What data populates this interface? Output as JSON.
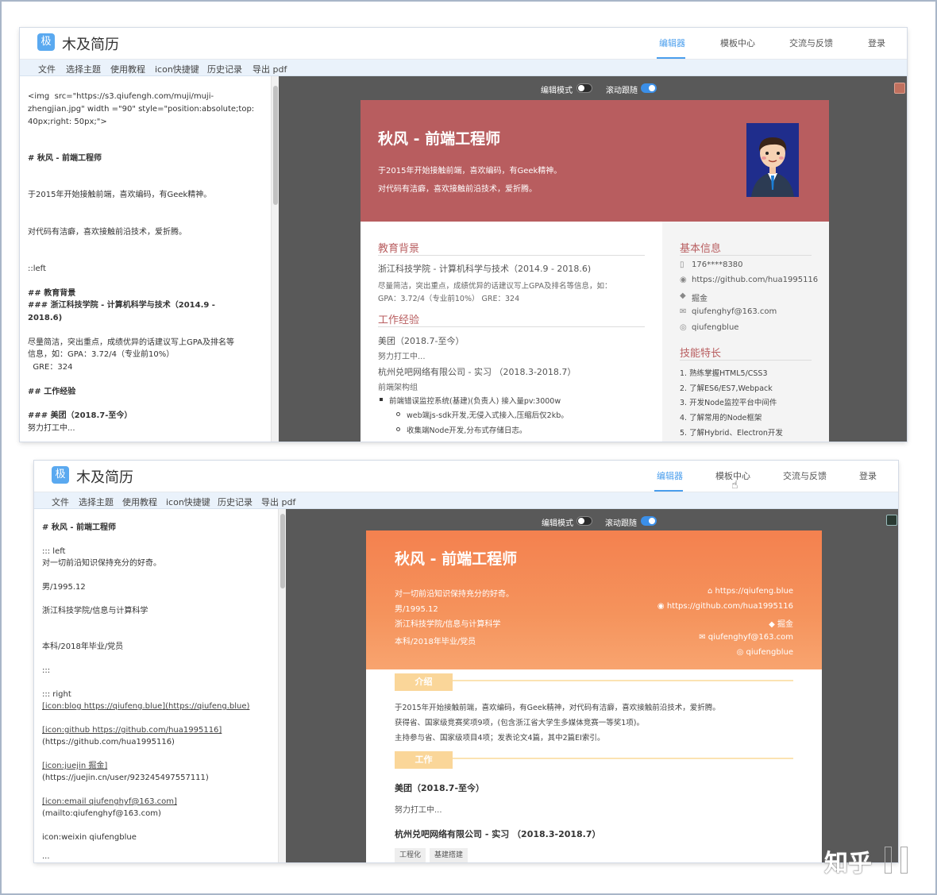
{
  "app": {
    "logo_glyph": "极",
    "title": "木及简历"
  },
  "nav": {
    "editor": "编辑器",
    "templates": "模板中心",
    "feedback": "交流与反馈",
    "login": "登录"
  },
  "menu": {
    "file": "文件",
    "theme": "选择主题",
    "tutorial": "使用教程",
    "icon_shortcut": "icon快捷键",
    "history": "历史记录",
    "export_pdf": "导出 pdf"
  },
  "toggles": {
    "edit_mode": "编辑模式",
    "edit_mode_on": false,
    "scroll_follow": "滚动跟随",
    "scroll_follow_on": true
  },
  "shot1": {
    "editor": {
      "img_line1": "<img  src=\"https://s3.qiufengh.com/muji/muji-",
      "img_line2": "zhengjian.jpg\" width =\"90\" style=\"position:absolute;top:",
      "img_line3": "40px;right: 50px;\">",
      "h1": "# 秋风 - 前端工程师",
      "p1": "于2015年开始接触前端，喜欢编码，有Geek精神。",
      "p2": "对代码有洁癖，喜欢接触前沿技术，爱折腾。",
      "left": "::left",
      "h2_edu": "## 教育背景",
      "h3_school_1": "### 浙江科技学院 - 计算机科学与技术（2014.9 -",
      "h3_school_2": "2018.6)",
      "edu_desc_1": "尽量简洁，突出重点，成绩优异的话建议写上GPA及排名等",
      "edu_desc_2": "信息，如：GPA：3.72/4（专业前10%）",
      "edu_desc_3": "  GRE：324",
      "h2_work": "## 工作经验",
      "h3_meituan": "### 美团（2018.7-至今）",
      "meituan_desc": "努力打工中..."
    },
    "resume": {
      "accent": "#b85d5f",
      "name": "秋风 - 前端工程师",
      "intro1": "于2015年开始接触前端，喜欢编码，有Geek精神。",
      "intro2": "对代码有洁癖，喜欢接触前沿技术，爱折腾。",
      "edu_title": "教育背景",
      "school": "浙江科技学院 - 计算机科学与技术（2014.9 - 2018.6)",
      "edu_desc1": "尽量简洁，突出重点，成绩优异的话建议写上GPA及排名等信息，如：",
      "edu_desc2": "GPA：3.72/4（专业前10%） GRE：324",
      "work_title": "工作经验",
      "job1": "美团（2018.7-至今）",
      "job1_desc": "努力打工中...",
      "job2": "杭州兑吧网络有限公司 - 实习 （2018.3-2018.7）",
      "job2_team": "前端架构组",
      "bullet1": "前端错误监控系统(基建)(负责人) 接入量pv:3000w",
      "sub1": "web端js-sdk开发,无侵入式接入,压缩后仅2kb。",
      "sub2": "收集端Node开发,分布式存储日志。",
      "info_title": "基本信息",
      "phone": "176****8380",
      "github": "https://github.com/hua1995116",
      "juejin": "掘金",
      "email": "qiufenghyf@163.com",
      "weixin": "qiufengblue",
      "skill_title": "技能特长",
      "skills": [
        "1. 熟练掌握HTML5/CSS3",
        "2. 了解ES6/ES7,Webpack",
        "3. 开发Node监控平台中间件",
        "4. 了解常用的Node框架",
        "5. 了解Hybrid、Electron开发"
      ]
    }
  },
  "shot2": {
    "editor": {
      "h1": "# 秋风 - 前端工程师",
      "left": "::: left",
      "l1": "对一切前沿知识保持充分的好奇。",
      "l2": "男/1995.12",
      "l3": "浙江科技学院/信息与计算科学",
      "l4": "本科/2018年毕业/党员",
      "sep": ":::",
      "right": "::: right",
      "blog1": "[icon:blog https://qiufeng.blue](https://qiufeng.blue)",
      "gh1": "[icon:github https://github.com/hua1995116]",
      "gh2": "(https://github.com/hua1995116)",
      "jj1": "[icon:juejin 掘金]",
      "jj2": "(https://juejin.cn/user/923245497557111)",
      "em1": "[icon:email qiufenghyf@163.com]",
      "em2": "(mailto:qiufenghyf@163.com)",
      "wx": "icon:weixin qiufengblue",
      "more": "..."
    },
    "resume": {
      "accent": "#f5834f",
      "name": "秋风 - 前端工程师",
      "l1": "对一切前沿知识保持充分的好奇。",
      "l2": "男/1995.12",
      "l3": "浙江科技学院/信息与计算科学",
      "l4": "本科/2018年毕业/党员",
      "blog": "https://qiufeng.blue",
      "github": "https://github.com/hua1995116",
      "juejin": "掘金",
      "email": "qiufenghyf@163.com",
      "weixin": "qiufengblue",
      "intro_tag": "介绍",
      "intro1": "于2015年开始接触前端，喜欢编码，有Geek精神，对代码有洁癖，喜欢接触前沿技术，爱折腾。",
      "intro2": "获得省、国家级竞赛奖项9项，(包含浙江省大学生多媒体竞赛一等奖1项)。",
      "intro3": "主持参与省、国家级项目4项；发表论文4篇，其中2篇EI索引。",
      "work_tag": "工作",
      "job1": "美团（2018.7-至今）",
      "job1_desc": "努力打工中...",
      "job2": "杭州兑吧网络有限公司 - 实习 （2018.3-2018.7）",
      "tag1": "工程化",
      "tag2": "基建搭建"
    }
  },
  "watermark": "知乎"
}
